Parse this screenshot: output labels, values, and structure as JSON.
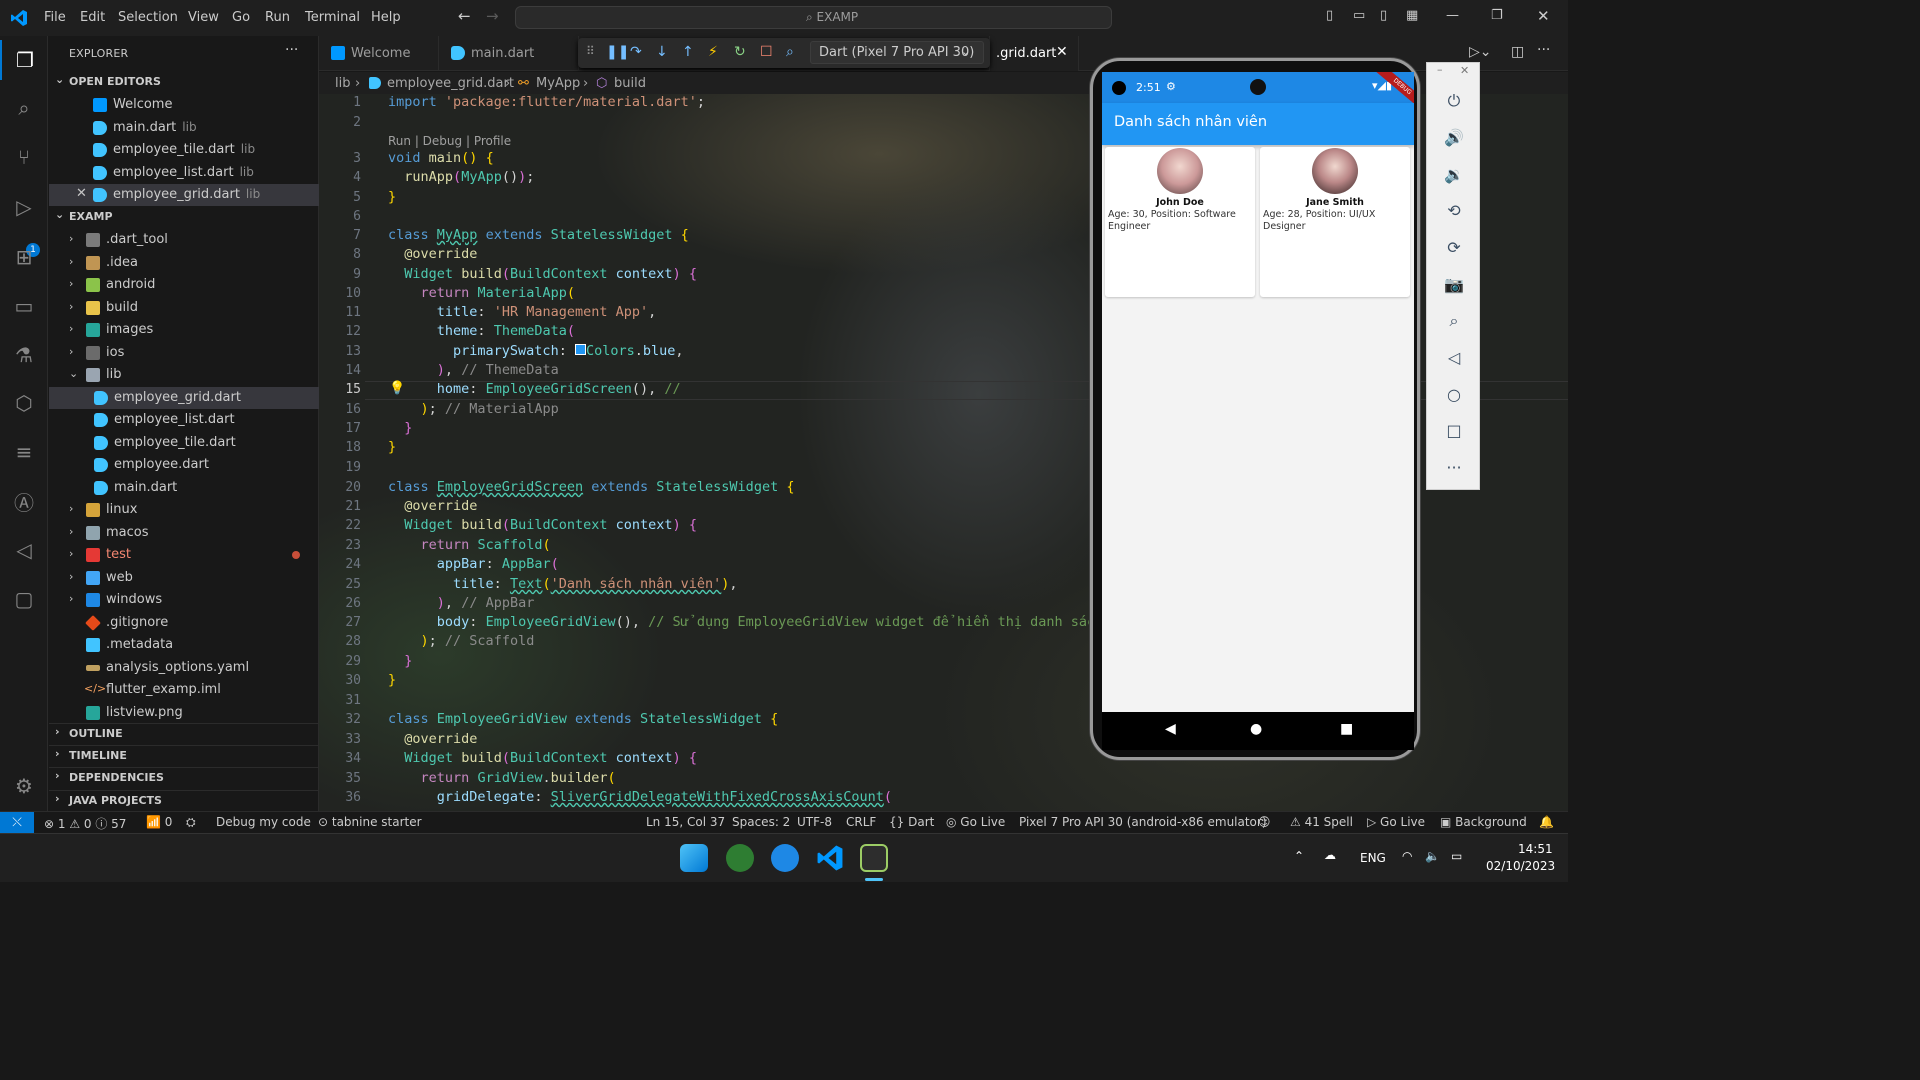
{
  "menu": [
    "File",
    "Edit",
    "Selection",
    "View",
    "Go",
    "Run",
    "Terminal",
    "Help"
  ],
  "command_center": "EXAMP",
  "sidebar": {
    "title": "EXPLORER",
    "open_editors_label": "OPEN EDITORS",
    "open_editors": [
      {
        "name": "Welcome",
        "dir": ""
      },
      {
        "name": "main.dart",
        "dir": "lib"
      },
      {
        "name": "employee_tile.dart",
        "dir": "lib"
      },
      {
        "name": "employee_list.dart",
        "dir": "lib"
      },
      {
        "name": "employee_grid.dart",
        "dir": "lib"
      }
    ],
    "project_label": "EXAMP",
    "tree": [
      {
        "name": ".dart_tool"
      },
      {
        "name": ".idea"
      },
      {
        "name": "android"
      },
      {
        "name": "build"
      },
      {
        "name": "images"
      },
      {
        "name": "ios"
      },
      {
        "name": "lib"
      },
      {
        "name": "employee_grid.dart"
      },
      {
        "name": "employee_list.dart"
      },
      {
        "name": "employee_tile.dart"
      },
      {
        "name": "employee.dart"
      },
      {
        "name": "main.dart"
      },
      {
        "name": "linux"
      },
      {
        "name": "macos"
      },
      {
        "name": "test"
      },
      {
        "name": "web"
      },
      {
        "name": "windows"
      },
      {
        "name": ".gitignore"
      },
      {
        "name": ".metadata"
      },
      {
        "name": "analysis_options.yaml"
      },
      {
        "name": "flutter_examp.iml"
      },
      {
        "name": "listview.png"
      }
    ],
    "outline_label": "OUTLINE",
    "timeline_label": "TIMELINE",
    "dependencies_label": "DEPENDENCIES",
    "java_label": "JAVA PROJECTS"
  },
  "tabs": [
    {
      "label": "Welcome"
    },
    {
      "label": "main.dart"
    },
    {
      "label": ".grid.dart"
    }
  ],
  "debug_target": "Dart (Pixel 7 Pro API 30)",
  "breadcrumb": [
    "lib",
    "employee_grid.dart",
    "MyApp",
    "build"
  ],
  "code_lens": "Run | Debug | Profile",
  "emulator": {
    "time": "2:51",
    "app_title": "Danh sách nhân viên",
    "employees": [
      {
        "name": "John Doe",
        "info": "Age: 30, Position: Software Engineer"
      },
      {
        "name": "Jane Smith",
        "info": "Age: 28, Position: UI/UX Designer"
      }
    ],
    "debug_banner": "DEBUG"
  },
  "statusbar": {
    "problems": "1 ⚠ 0 ⓘ 57",
    "ports": "0",
    "debug": "Debug my code",
    "tabnine": "tabnine starter",
    "position": "Ln 15, Col 37",
    "spaces": "Spaces: 2",
    "encoding": "UTF-8",
    "eol": "CRLF",
    "language": "Dart",
    "golive1": "Go Live",
    "device": "Pixel 7 Pro API 30 (android-x86 emulator)",
    "spell": "41 Spell",
    "golive2": "Go Live",
    "background": "Background"
  },
  "taskbar": {
    "lang": "ENG",
    "time": "14:51",
    "date": "02/10/2023"
  },
  "colors": {
    "accent": "#0078d4",
    "appbar": "#2196f3",
    "statusbar_phone": "#1e88e5"
  }
}
